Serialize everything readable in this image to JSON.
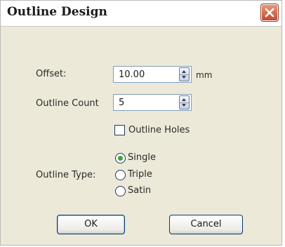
{
  "dialog": {
    "title": "Outline Design",
    "close_icon": "close-x-icon",
    "close_color": "#d9583a"
  },
  "offset": {
    "label": "Offset:",
    "value": "10.00",
    "unit": "mm"
  },
  "outline_count": {
    "label": "Outline Count",
    "value": "5"
  },
  "outline_holes": {
    "label": "Outline Holes",
    "checked": false
  },
  "outline_type": {
    "label": "Outline Type:",
    "options": [
      {
        "label": "Single",
        "selected": true
      },
      {
        "label": "Triple",
        "selected": false
      },
      {
        "label": "Satin",
        "selected": false
      }
    ]
  },
  "buttons": {
    "ok": "OK",
    "cancel": "Cancel"
  }
}
